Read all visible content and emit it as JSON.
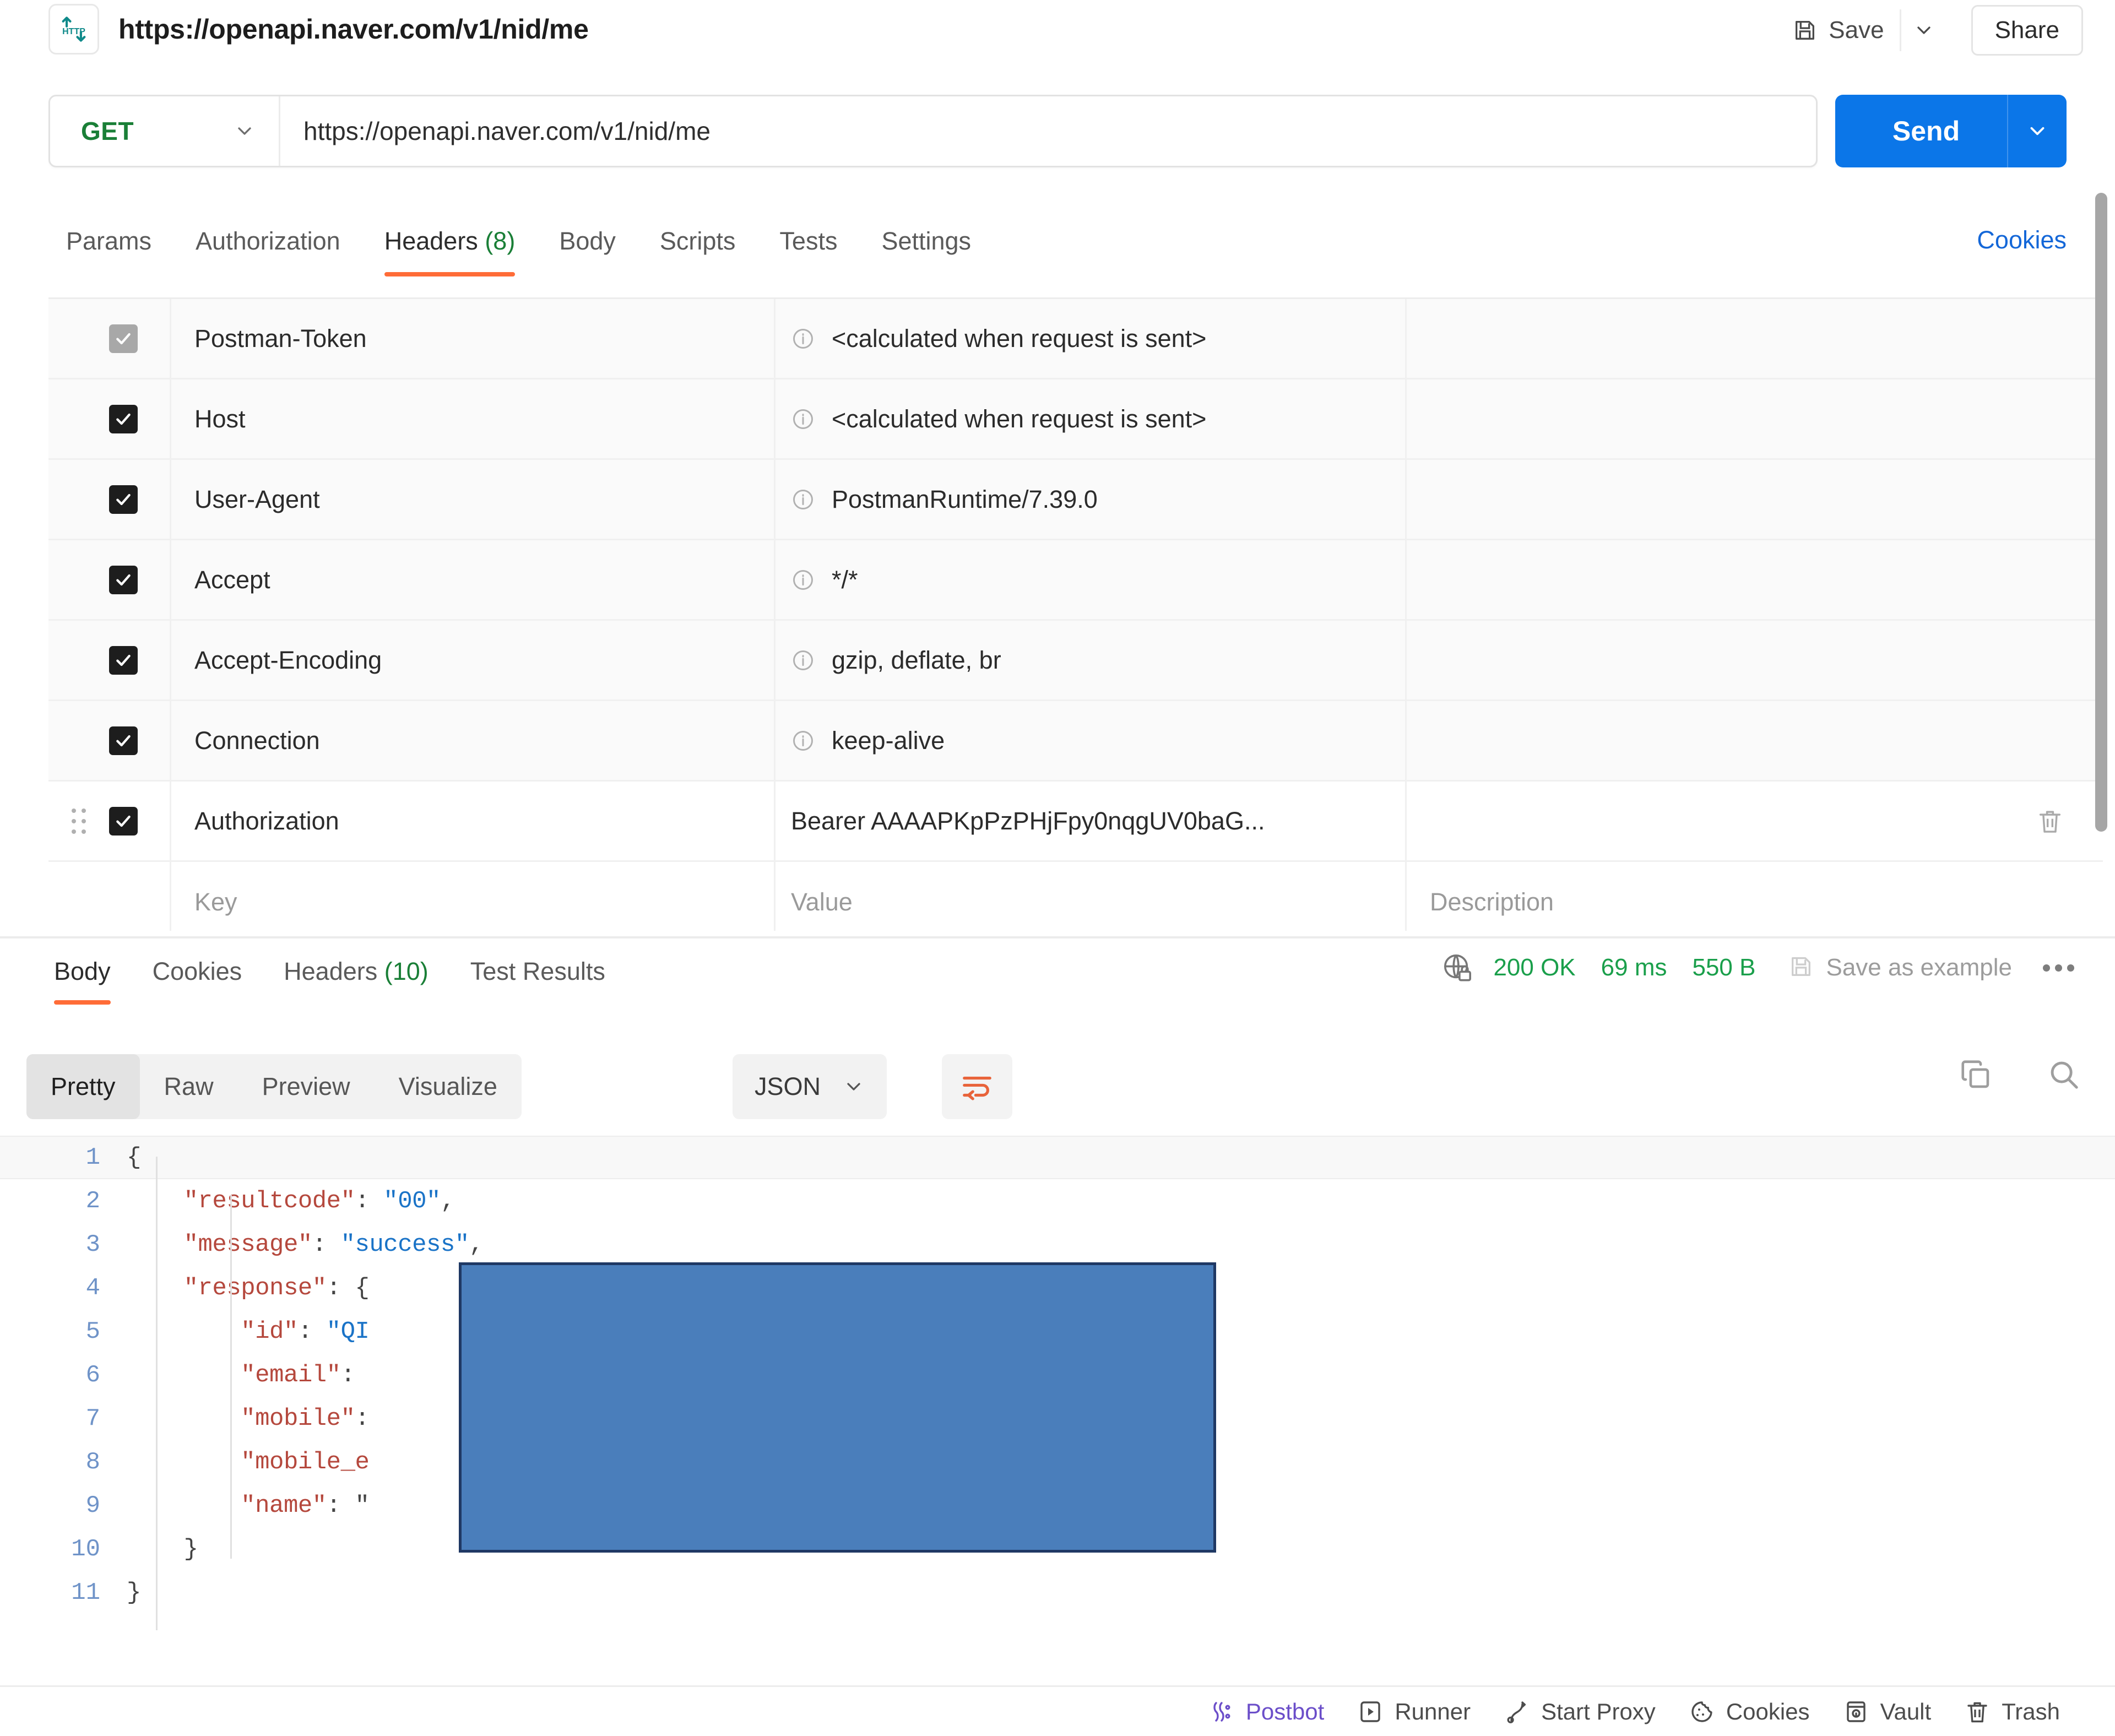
{
  "topbar": {
    "protocol_badge": "HTTP",
    "request_title": "https://openapi.naver.com/v1/nid/me",
    "save_label": "Save",
    "share_label": "Share"
  },
  "urlbar": {
    "method": "GET",
    "url": "https://openapi.naver.com/v1/nid/me",
    "send_label": "Send"
  },
  "request_tabs": {
    "items": [
      {
        "label": "Params",
        "active": false
      },
      {
        "label": "Authorization",
        "active": false
      },
      {
        "label": "Headers",
        "count": "(8)",
        "active": true
      },
      {
        "label": "Body",
        "active": false
      },
      {
        "label": "Scripts",
        "active": false
      },
      {
        "label": "Tests",
        "active": false
      },
      {
        "label": "Settings",
        "active": false
      }
    ],
    "cookies_link": "Cookies"
  },
  "headers_table": {
    "placeholders": {
      "key": "Key",
      "value": "Value",
      "description": "Description"
    },
    "rows": [
      {
        "checked": true,
        "muted": true,
        "key": "Postman-Token",
        "value": "<calculated when request is sent>",
        "info": true,
        "shaded": true
      },
      {
        "checked": true,
        "muted": false,
        "key": "Host",
        "value": "<calculated when request is sent>",
        "info": true,
        "shaded": true
      },
      {
        "checked": true,
        "muted": false,
        "key": "User-Agent",
        "value": "PostmanRuntime/7.39.0",
        "info": true,
        "shaded": true
      },
      {
        "checked": true,
        "muted": false,
        "key": "Accept",
        "value": "*/*",
        "info": true,
        "shaded": true
      },
      {
        "checked": true,
        "muted": false,
        "key": "Accept-Encoding",
        "value": "gzip, deflate, br",
        "info": true,
        "shaded": true
      },
      {
        "checked": true,
        "muted": false,
        "key": "Connection",
        "value": "keep-alive",
        "info": true,
        "shaded": true
      },
      {
        "checked": true,
        "muted": false,
        "key": "Authorization",
        "value": "Bearer AAAAPKpPzPHjFpy0nqgUV0baG...",
        "info": false,
        "shaded": false,
        "drag": true,
        "trash": true
      }
    ]
  },
  "response": {
    "tabs": [
      {
        "label": "Body",
        "active": true
      },
      {
        "label": "Cookies",
        "active": false
      },
      {
        "label": "Headers",
        "count": "(10)",
        "active": false
      },
      {
        "label": "Test Results",
        "active": false
      }
    ],
    "status": "200 OK",
    "time": "69 ms",
    "size": "550 B",
    "save_as_example": "Save as example"
  },
  "body_toolbar": {
    "views": [
      {
        "label": "Pretty",
        "active": true
      },
      {
        "label": "Raw",
        "active": false
      },
      {
        "label": "Preview",
        "active": false
      },
      {
        "label": "Visualize",
        "active": false
      }
    ],
    "format": "JSON"
  },
  "code": {
    "lines": [
      {
        "n": "1",
        "segments": [
          {
            "t": "{",
            "c": "punc"
          }
        ],
        "highlighted": true
      },
      {
        "n": "2",
        "segments": [
          {
            "t": "    ",
            "c": "punc"
          },
          {
            "t": "\"resultcode\"",
            "c": "key"
          },
          {
            "t": ": ",
            "c": "punc"
          },
          {
            "t": "\"00\"",
            "c": "str"
          },
          {
            "t": ",",
            "c": "punc"
          }
        ]
      },
      {
        "n": "3",
        "segments": [
          {
            "t": "    ",
            "c": "punc"
          },
          {
            "t": "\"message\"",
            "c": "key"
          },
          {
            "t": ": ",
            "c": "punc"
          },
          {
            "t": "\"success\"",
            "c": "str"
          },
          {
            "t": ",",
            "c": "punc"
          }
        ]
      },
      {
        "n": "4",
        "segments": [
          {
            "t": "    ",
            "c": "punc"
          },
          {
            "t": "\"response\"",
            "c": "key"
          },
          {
            "t": ": ",
            "c": "punc"
          },
          {
            "t": "{",
            "c": "punc"
          }
        ]
      },
      {
        "n": "5",
        "segments": [
          {
            "t": "        ",
            "c": "punc"
          },
          {
            "t": "\"id\"",
            "c": "key"
          },
          {
            "t": ": ",
            "c": "punc"
          },
          {
            "t": "\"QI",
            "c": "str"
          }
        ]
      },
      {
        "n": "6",
        "segments": [
          {
            "t": "        ",
            "c": "punc"
          },
          {
            "t": "\"email\"",
            "c": "key"
          },
          {
            "t": ": ",
            "c": "punc"
          }
        ]
      },
      {
        "n": "7",
        "segments": [
          {
            "t": "        ",
            "c": "punc"
          },
          {
            "t": "\"mobile\"",
            "c": "key"
          },
          {
            "t": ":",
            "c": "punc"
          }
        ]
      },
      {
        "n": "8",
        "segments": [
          {
            "t": "        ",
            "c": "punc"
          },
          {
            "t": "\"mobile_e",
            "c": "key"
          }
        ]
      },
      {
        "n": "9",
        "segments": [
          {
            "t": "        ",
            "c": "punc"
          },
          {
            "t": "\"name\"",
            "c": "key"
          },
          {
            "t": ": \"",
            "c": "punc"
          }
        ]
      },
      {
        "n": "10",
        "segments": [
          {
            "t": "    }",
            "c": "punc"
          }
        ]
      },
      {
        "n": "11",
        "segments": [
          {
            "t": "}",
            "c": "punc"
          }
        ]
      }
    ],
    "redaction_color": "#4a7ebb",
    "redaction_border_color": "#1f3864"
  },
  "bottom_bar": {
    "items": [
      {
        "label": "Postbot",
        "icon": "postbot-icon",
        "accent": true
      },
      {
        "label": "Runner",
        "icon": "runner-icon",
        "accent": false
      },
      {
        "label": "Start Proxy",
        "icon": "proxy-icon",
        "accent": false
      },
      {
        "label": "Cookies",
        "icon": "cookies-icon",
        "accent": false
      },
      {
        "label": "Vault",
        "icon": "vault-icon",
        "accent": false
      },
      {
        "label": "Trash",
        "icon": "trash-icon",
        "accent": false
      }
    ]
  },
  "colors": {
    "accent_orange": "#ff6c37",
    "send_blue": "#0b76e8",
    "method_green": "#1a7f37",
    "status_green": "#1a9f4b",
    "link_blue": "#1467d8"
  }
}
